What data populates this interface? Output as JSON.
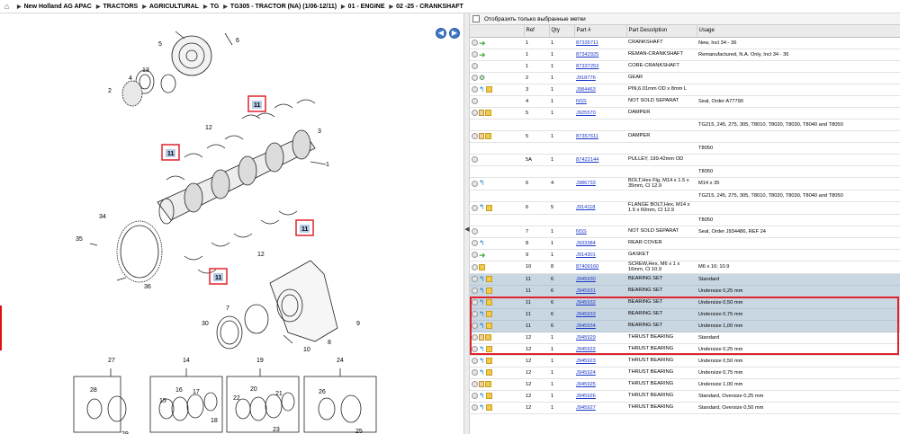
{
  "breadcrumb": [
    "New Holland AG APAC",
    "TRACTORS",
    "AGRICULTURAL",
    "TG",
    "TG305 - TRACTOR (NA) (1/06-12/11)",
    "01 - ENGINE",
    "02 -25 - CRANKSHAFT"
  ],
  "filter_label": "Отобразить только выбранные метки",
  "columns": [
    "",
    "Ref",
    "Qty",
    "Part #",
    "Part Description",
    "Usage"
  ],
  "rows": [
    {
      "icons": [
        "add",
        "green"
      ],
      "ref": "1",
      "qty": "1",
      "part": "87335711",
      "desc": "CRANKSHAFT",
      "usage": "New, Incl 34 - 36"
    },
    {
      "icons": [
        "add",
        "green"
      ],
      "ref": "1",
      "qty": "1",
      "part": "87342925",
      "desc": "REMAN-CRANKSHAFT",
      "usage": "Remanufactured, N.A. Only, Incl 34 - 36"
    },
    {
      "icons": [
        "add"
      ],
      "ref": "1",
      "qty": "1",
      "part": "87337253",
      "desc": "CORE-CRANKSHAFT",
      "usage": ""
    },
    {
      "icons": [
        "add",
        "gear"
      ],
      "ref": "2",
      "qty": "1",
      "part": "J918776",
      "desc": "GEAR",
      "usage": ""
    },
    {
      "icons": [
        "add",
        "arrow",
        "box"
      ],
      "ref": "3",
      "qty": "1",
      "part": "J984463",
      "desc": "PIN,6.01mm OD x 8mm L",
      "usage": ""
    },
    {
      "icons": [
        "add"
      ],
      "ref": "4",
      "qty": "1",
      "part": "NSS",
      "desc": "NOT SOLD SEPARAT",
      "usage": "Seal, Order A77790"
    },
    {
      "icons": [
        "add",
        "doc",
        "box"
      ],
      "ref": "5",
      "qty": "1",
      "part": "J925570",
      "desc": "DAMPER",
      "usage": ""
    },
    {
      "icons": [],
      "ref": "",
      "qty": "",
      "part": "",
      "desc": "",
      "usage": "TG215, 245, 275, 305, T8010, T8020, T8030, T8040 and T8050"
    },
    {
      "icons": [
        "add",
        "doc",
        "box"
      ],
      "ref": "5",
      "qty": "1",
      "part": "87357611",
      "desc": "DAMPER",
      "usage": ""
    },
    {
      "icons": [],
      "ref": "",
      "qty": "",
      "part": "",
      "desc": "",
      "usage": "T8050"
    },
    {
      "icons": [
        "add"
      ],
      "ref": "5A",
      "qty": "1",
      "part": "87422144",
      "desc": "PULLEY, 199.42mm OD",
      "usage": ""
    },
    {
      "icons": [],
      "ref": "",
      "qty": "",
      "part": "",
      "desc": "",
      "usage": "T8050"
    },
    {
      "icons": [
        "add",
        "arrow"
      ],
      "ref": "6",
      "qty": "4",
      "part": "J986733",
      "desc": "BOLT,Hex Flg, M14 x 1.5 x 35mm, Cl 12.9",
      "usage": "M14 x 35"
    },
    {
      "icons": [],
      "ref": "",
      "qty": "",
      "part": "",
      "desc": "",
      "usage": "TG215, 245, 275, 305, T8010, T8020, T8030, T8040 and T8050"
    },
    {
      "icons": [
        "add",
        "arrow",
        "box"
      ],
      "ref": "6",
      "qty": "5",
      "part": "J914118",
      "desc": "FLANGE BOLT,Hex, M14 x 1.5 x 60mm, Cl 12.9",
      "usage": ""
    },
    {
      "icons": [],
      "ref": "",
      "qty": "",
      "part": "",
      "desc": "",
      "usage": "T8050"
    },
    {
      "icons": [
        "add"
      ],
      "ref": "7",
      "qty": "1",
      "part": "NSS",
      "desc": "NOT SOLD SEPARAT",
      "usage": "Seal, Order J934486, REF 24"
    },
    {
      "icons": [
        "add",
        "arrow"
      ],
      "ref": "8",
      "qty": "1",
      "part": "J933384",
      "desc": "REAR COVER",
      "usage": ""
    },
    {
      "icons": [
        "add",
        "green"
      ],
      "ref": "9",
      "qty": "1",
      "part": "J914301",
      "desc": "GASKET",
      "usage": ""
    },
    {
      "icons": [
        "add",
        "box"
      ],
      "ref": "10",
      "qty": "8",
      "part": "87409160",
      "desc": "SCREW,Hex, M6 x 1 x 16mm, Cl 10.9",
      "usage": "M6 x 16; 10.9"
    },
    {
      "icons": [
        "add",
        "arrow",
        "box"
      ],
      "ref": "11",
      "qty": "6",
      "part": "J945930",
      "desc": "BEARING SET",
      "usage": "Standard",
      "sel": true
    },
    {
      "icons": [
        "add",
        "arrow",
        "box"
      ],
      "ref": "11",
      "qty": "6",
      "part": "J945931",
      "desc": "BEARING SET",
      "usage": "Undersize 0,25 mm",
      "sel": true
    },
    {
      "icons": [
        "add",
        "arrow",
        "box"
      ],
      "ref": "11",
      "qty": "6",
      "part": "J945932",
      "desc": "BEARING SET",
      "usage": "Undersize 0,50 mm",
      "sel": true
    },
    {
      "icons": [
        "add",
        "arrow",
        "box"
      ],
      "ref": "11",
      "qty": "6",
      "part": "J945933",
      "desc": "BEARING SET",
      "usage": "Undersize 0,75 mm",
      "sel": true
    },
    {
      "icons": [
        "add",
        "arrow",
        "box"
      ],
      "ref": "11",
      "qty": "6",
      "part": "J945934",
      "desc": "BEARING SET",
      "usage": "Undersize 1,00 mm",
      "sel": true
    },
    {
      "icons": [
        "add",
        "doc",
        "box"
      ],
      "ref": "12",
      "qty": "1",
      "part": "J945929",
      "desc": "THRUST BEARING",
      "usage": "Standard"
    },
    {
      "icons": [
        "add",
        "arrow",
        "box"
      ],
      "ref": "12",
      "qty": "1",
      "part": "J945922",
      "desc": "THRUST BEARING",
      "usage": "Undersize 0,25 mm"
    },
    {
      "icons": [
        "add",
        "arrow",
        "box"
      ],
      "ref": "12",
      "qty": "1",
      "part": "J945923",
      "desc": "THRUST BEARING",
      "usage": "Undersize 0,50 mm"
    },
    {
      "icons": [
        "add",
        "arrow",
        "box"
      ],
      "ref": "12",
      "qty": "1",
      "part": "J945924",
      "desc": "THRUST BEARING",
      "usage": "Undersize 0,75 mm"
    },
    {
      "icons": [
        "add",
        "doc",
        "box"
      ],
      "ref": "12",
      "qty": "1",
      "part": "J945925",
      "desc": "THRUST BEARING",
      "usage": "Undersize 1,00 mm"
    },
    {
      "icons": [
        "add",
        "arrow",
        "box"
      ],
      "ref": "12",
      "qty": "1",
      "part": "J945926",
      "desc": "THRUST BEARING",
      "usage": "Standard, Oversize 0,25 mm"
    },
    {
      "icons": [
        "add",
        "arrow",
        "box"
      ],
      "ref": "12",
      "qty": "1",
      "part": "J945927",
      "desc": "THRUST BEARING",
      "usage": "Standard, Oversize 0,50 mm"
    }
  ],
  "diagram": {
    "labels": [
      "5",
      "6",
      "4",
      "13",
      "2",
      "11",
      "12",
      "3",
      "11",
      "1",
      "34",
      "11",
      "35",
      "12",
      "11",
      "36",
      "7",
      "30",
      "8",
      "9",
      "10",
      "27",
      "14",
      "19",
      "24",
      "28",
      "29",
      "15",
      "16",
      "17",
      "18",
      "22",
      "20",
      "21",
      "23",
      "26",
      "25"
    ],
    "nav_prev": "◀",
    "nav_next": "▶"
  }
}
